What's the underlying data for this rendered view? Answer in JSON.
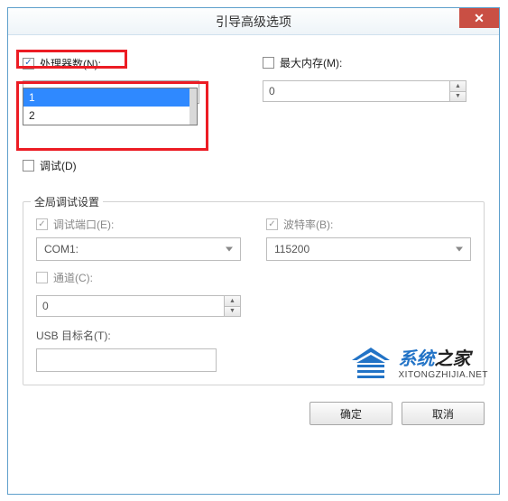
{
  "window": {
    "title": "引导高级选项"
  },
  "close": {
    "glyph": "✕"
  },
  "processor": {
    "label": "处理器数(N):",
    "checked": true,
    "value": "1",
    "options": [
      "1",
      "2"
    ]
  },
  "maxmem": {
    "label": "最大内存(M):",
    "checked": false,
    "value": "0"
  },
  "debug": {
    "label": "调试(D)",
    "checked": false
  },
  "group": {
    "legend": "全局调试设置",
    "port": {
      "label": "调试端口(E):",
      "value": "COM1:",
      "checked": true
    },
    "baud": {
      "label": "波特率(B):",
      "value": "115200",
      "checked": true
    },
    "channel": {
      "label": "通道(C):",
      "value": "0",
      "checked": false
    },
    "usb": {
      "label": "USB 目标名(T):",
      "value": ""
    }
  },
  "buttons": {
    "ok": "确定",
    "cancel": "取消"
  },
  "watermark": {
    "big_pre": "系统",
    "big_post": "之家",
    "sub": "XITONGZHIJIA.NET"
  }
}
